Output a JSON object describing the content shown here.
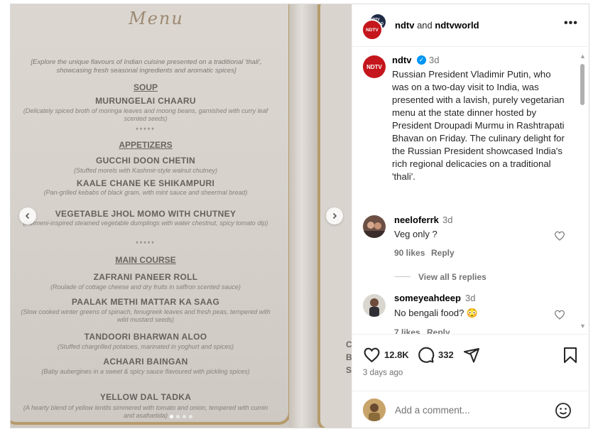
{
  "photo": {
    "menu_title": "Menu",
    "intro": "[Explore the unique flavours of Indian cuisine presented on a traditional 'thali', showcasing fresh seasonal ingredients and aromatic spices]",
    "sections": {
      "soup": "SOUP",
      "appetizers": "APPETIZERS",
      "main_course": "MAIN COURSE"
    },
    "stars": "*****",
    "dishes": [
      {
        "name": "MURUNGELAI CHAARU",
        "desc": "(Delicately spiced broth of moringa leaves and moong beans, garnished with curry leaf scented seeds)"
      },
      {
        "name": "GUCCHI DOON CHETIN",
        "desc": "(Stuffed morels with Kashmir-style walnut chutney)"
      },
      {
        "name": "KAALE CHANE KE SHIKAMPURI",
        "desc": "(Pan-grilled kebabs of black gram, with mint sauce and sheermal bread)"
      },
      {
        "name": "VEGETABLE JHOL MOMO WITH CHUTNEY",
        "desc": "(Pelmeni-inspired steamed vegetable dumplings with water chestnut, spicy tomato dip)"
      },
      {
        "name": "ZAFRANI PANEER ROLL",
        "desc": "(Roulade of cottage cheese and dry fruits in saffron scented sauce)"
      },
      {
        "name": "PAALAK METHI MATTAR KA SAAG",
        "desc": "(Slow cooked winter greens of spinach, fenugreek leaves and fresh peas, tempered with wild mustard seeds)"
      },
      {
        "name": "TANDOORI BHARWAN ALOO",
        "desc": "(Stuffed chargrilled potatoes, marinated in yoghurt and spices)"
      },
      {
        "name": "ACHAARI BAINGAN",
        "desc": "(Baby aubergines in a sweet & spicy sauce flavoured with pickling spices)"
      },
      {
        "name": "YELLOW DAL TADKA",
        "desc": "(A hearty blend of yellow lentils simmered with tomato and onion, tempered with cumin and asafoetida)"
      }
    ],
    "side_letters": [
      "C",
      "B",
      "S"
    ],
    "carousel": {
      "total": 4,
      "active_index": 0
    }
  },
  "header": {
    "avatar_ndtv": "NDTV",
    "avatar_world": "NDTV WORLD",
    "user1": "ndtv",
    "and": "and",
    "user2": "ndtvworld",
    "more": "•••"
  },
  "caption": {
    "user": "ndtv",
    "time": "3d",
    "text": "Russian President Vladimir Putin, who was on a two-day visit to India, was presented with a lavish, purely vegetarian menu at the state dinner hosted by President Droupadi Murmu in Rashtrapati Bhavan on Friday. The culinary delight for the Russian President showcased India's rich regional delicacies on a traditional 'thali'."
  },
  "comments": [
    {
      "user": "neeloferrk",
      "time": "3d",
      "text": "Veg only ?",
      "likes": "90 likes",
      "reply": "Reply",
      "view_replies": "View all 5 replies"
    },
    {
      "user": "someyeahdeep",
      "time": "3d",
      "text": "No bengali food? 😳",
      "likes": "7 likes",
      "reply": "Reply"
    }
  ],
  "actions": {
    "like_count": "12.8K",
    "comment_count": "332",
    "posted": "3 days ago"
  },
  "add_comment": {
    "placeholder": "Add a comment..."
  },
  "colors": {
    "brand_red": "#c4161c",
    "verified_blue": "#0095f6",
    "border": "#dbdbdb",
    "menu_gold": "#b69b6b"
  }
}
